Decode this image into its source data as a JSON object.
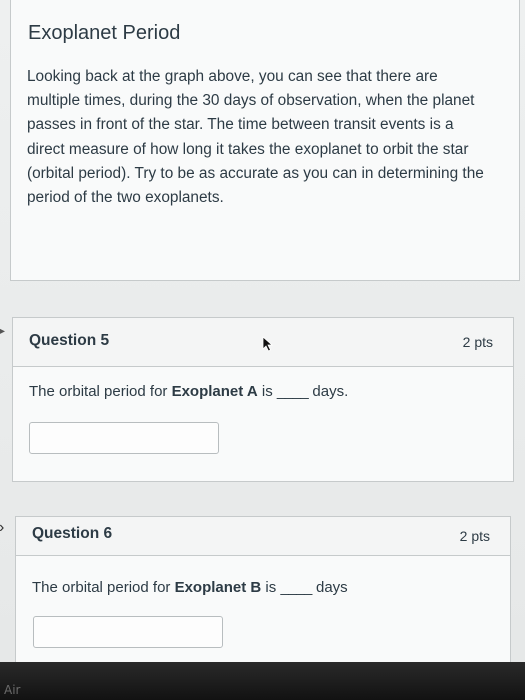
{
  "intro": {
    "title": "Exoplanet Period",
    "lines": [
      "Looking back at the graph above, you can see that there are",
      "multiple times, during the 30 days of observation, when the planet",
      "passes in front of the star. The time between transit events is a",
      "direct measure of how long it takes the exoplanet to orbit the star",
      "(orbital period). Try to be as accurate as you can in determining the",
      "period of the two exoplanets."
    ]
  },
  "question5": {
    "title": "Question 5",
    "points": "2 pts",
    "prefix": "The orbital period for ",
    "subject": "Exoplanet A",
    "middle": " is ",
    "blank": "____",
    "suffix": " days.",
    "answer": ""
  },
  "question6": {
    "title": "Question 6",
    "points": "2 pts",
    "prefix": "The orbital period for ",
    "subject": "Exoplanet B",
    "middle": " is ",
    "blank": "____",
    "suffix": " days",
    "answer": ""
  },
  "bezel": {
    "label": "Air"
  }
}
